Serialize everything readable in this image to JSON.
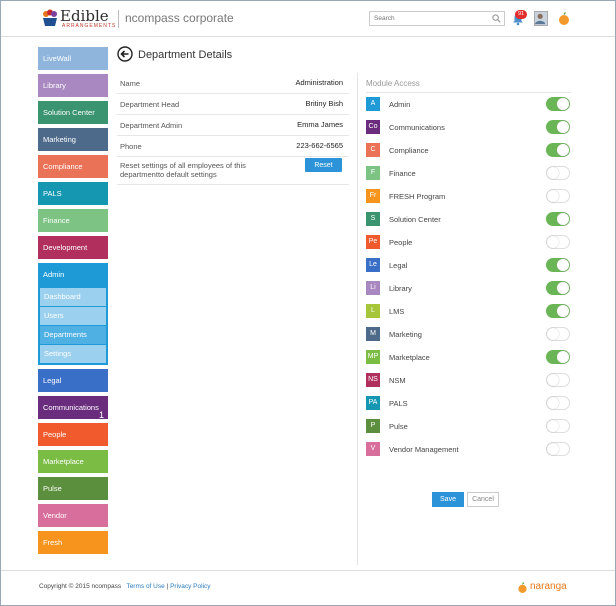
{
  "header": {
    "logo_text": "Edible",
    "logo_sub": "ARRANGEMENTS",
    "company": "ncompass corporate",
    "search_placeholder": "Search",
    "notification_count": "91"
  },
  "sidebar": {
    "items": [
      {
        "label": "LiveWall",
        "color": "#8fb5dc"
      },
      {
        "label": "Library",
        "color": "#a987c0"
      },
      {
        "label": "Solution Center",
        "color": "#3a9470"
      },
      {
        "label": "Marketing",
        "color": "#4e6a8a"
      },
      {
        "label": "Compliance",
        "color": "#ea7256"
      },
      {
        "label": "PALS",
        "color": "#1597b2"
      },
      {
        "label": "Finance",
        "color": "#7dc384"
      },
      {
        "label": "Development",
        "color": "#b02f5c"
      },
      {
        "label": "Admin",
        "color": "#1e9bd7"
      }
    ],
    "admin_sub": [
      {
        "label": "Dashboard"
      },
      {
        "label": "Users"
      },
      {
        "label": "Departments"
      },
      {
        "label": "Settings"
      }
    ],
    "items_after": [
      {
        "label": "Legal",
        "color": "#3a6fc8",
        "count": ""
      },
      {
        "label": "Communications",
        "color": "#6a2d7e",
        "count": "1"
      },
      {
        "label": "People",
        "color": "#f05a2d",
        "count": ""
      },
      {
        "label": "Marketplace",
        "color": "#7bbc44",
        "count": ""
      },
      {
        "label": "Pulse",
        "color": "#5b8f3d",
        "count": ""
      },
      {
        "label": "Vendor",
        "color": "#d76e9b",
        "count": ""
      },
      {
        "label": "Fresh",
        "color": "#f7941d",
        "count": ""
      }
    ]
  },
  "page": {
    "title": "Department Details"
  },
  "details": {
    "rows": [
      {
        "label": "Name",
        "value": "Administration"
      },
      {
        "label": "Department Head",
        "value": "Britiny Bish"
      },
      {
        "label": "Department Admin",
        "value": "Emma James"
      },
      {
        "label": "Phone",
        "value": "223-662-6565"
      }
    ],
    "reset_text": "Reset settings of all employees of this departmentto default settings",
    "reset_label": "Reset"
  },
  "modules": {
    "heading": "Module Access",
    "items": [
      {
        "abbr": "A",
        "name": "Admin",
        "color": "#1e9bd7",
        "enabled": true
      },
      {
        "abbr": "Co",
        "name": "Communications",
        "color": "#6a2d7e",
        "enabled": true
      },
      {
        "abbr": "C",
        "name": "Compliance",
        "color": "#ea7256",
        "enabled": true
      },
      {
        "abbr": "F",
        "name": "Finance",
        "color": "#7dc384",
        "enabled": false
      },
      {
        "abbr": "Fr",
        "name": "FRESH Program",
        "color": "#f7941d",
        "enabled": false
      },
      {
        "abbr": "S",
        "name": "Solution Center",
        "color": "#3a9470",
        "enabled": true
      },
      {
        "abbr": "Pe",
        "name": "People",
        "color": "#f05a2d",
        "enabled": false
      },
      {
        "abbr": "Le",
        "name": "Legal",
        "color": "#3a6fc8",
        "enabled": true
      },
      {
        "abbr": "Li",
        "name": "Library",
        "color": "#a987c0",
        "enabled": true
      },
      {
        "abbr": "L",
        "name": "LMS",
        "color": "#a6c539",
        "enabled": true
      },
      {
        "abbr": "M",
        "name": "Marketing",
        "color": "#4e6a8a",
        "enabled": false
      },
      {
        "abbr": "MP",
        "name": "Marketplace",
        "color": "#7bbc44",
        "enabled": true
      },
      {
        "abbr": "NS",
        "name": "NSM",
        "color": "#b02f5c",
        "enabled": false
      },
      {
        "abbr": "PA",
        "name": "PALS",
        "color": "#1597b2",
        "enabled": false
      },
      {
        "abbr": "P",
        "name": "Pulse",
        "color": "#5b8f3d",
        "enabled": false
      },
      {
        "abbr": "V",
        "name": "Vendor Management",
        "color": "#d76e9b",
        "enabled": false
      }
    ]
  },
  "actions": {
    "save_label": "Save",
    "cancel_label": "Cancel"
  },
  "footer": {
    "copyright": "Copyright © 2015 ncompass",
    "terms": "Terms of Use",
    "sep": "|",
    "privacy": "Privacy Policy",
    "brand": "naranga"
  }
}
